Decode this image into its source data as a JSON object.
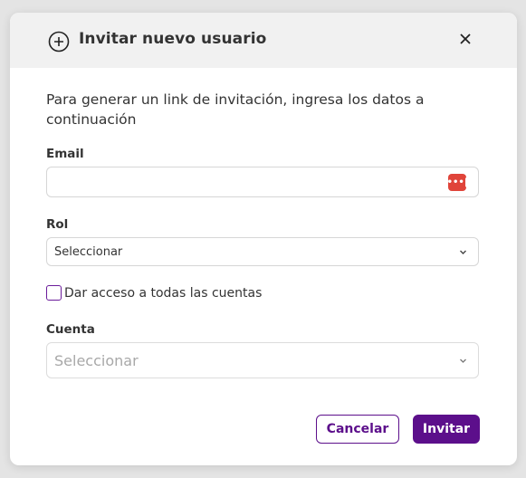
{
  "modal": {
    "title": "Invitar nuevo usuario",
    "intro": "Para generar un link de invitación, ingresa los datos a continuación"
  },
  "email": {
    "label": "Email",
    "value": "",
    "badge_text": "•••|"
  },
  "rol": {
    "label": "Rol",
    "selected": "Seleccionar"
  },
  "access": {
    "label": "Dar acceso a todas las cuentas",
    "checked": false
  },
  "cuenta": {
    "label": "Cuenta",
    "placeholder": "Seleccionar"
  },
  "actions": {
    "cancel_label": "Cancelar",
    "invite_label": "Invitar"
  },
  "colors": {
    "accent": "#5c0f8b",
    "badge": "#e0443a",
    "header_bg": "#f1f1f1"
  },
  "icons": {
    "header": "plus-circle-icon",
    "close": "close-icon",
    "dropdown": "chevron-down-icon",
    "password_manager": "password-manager-icon"
  }
}
